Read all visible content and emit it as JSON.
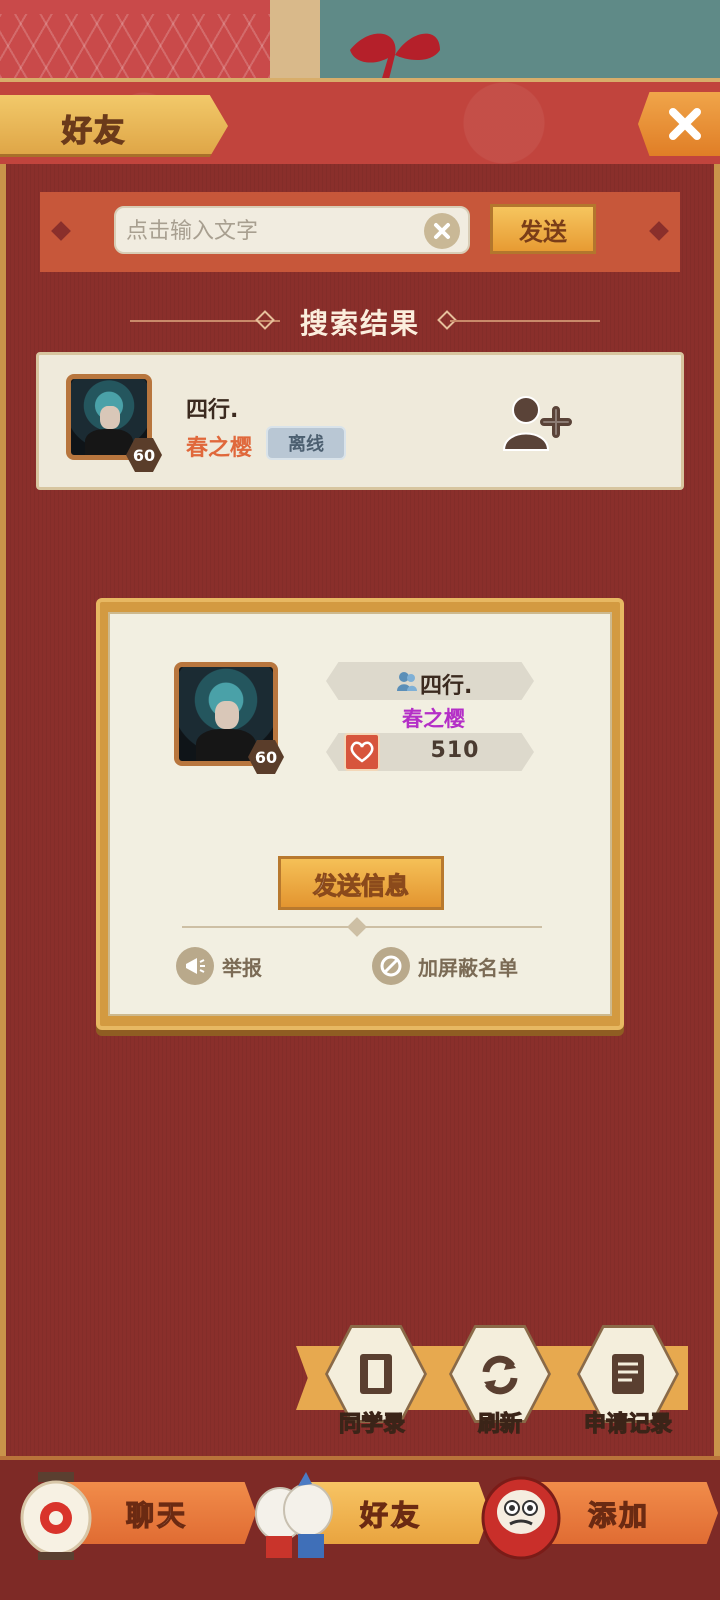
{
  "header": {
    "title": "好友"
  },
  "search": {
    "placeholder": "点击输入文字",
    "send_label": "发送"
  },
  "results": {
    "title": "搜索结果"
  },
  "result_item": {
    "name": "四行.",
    "guild": "春之樱",
    "status": "离线",
    "level": "60"
  },
  "profile": {
    "name": "四行.",
    "guild": "春之樱",
    "level": "60",
    "affection": "510",
    "send_message_label": "发送信息",
    "report_label": "举报",
    "block_label": "加屏蔽名单"
  },
  "actions": {
    "classmates": "同学录",
    "refresh": "刷新",
    "requests": "申请记录"
  },
  "nav": {
    "chat": "聊天",
    "friends": "好友",
    "add": "添加"
  },
  "colors": {
    "panel": "#8a2f2b",
    "accent": "#e79b33",
    "guild_result": "#e0683b",
    "guild_profile": "#b42ec7"
  }
}
